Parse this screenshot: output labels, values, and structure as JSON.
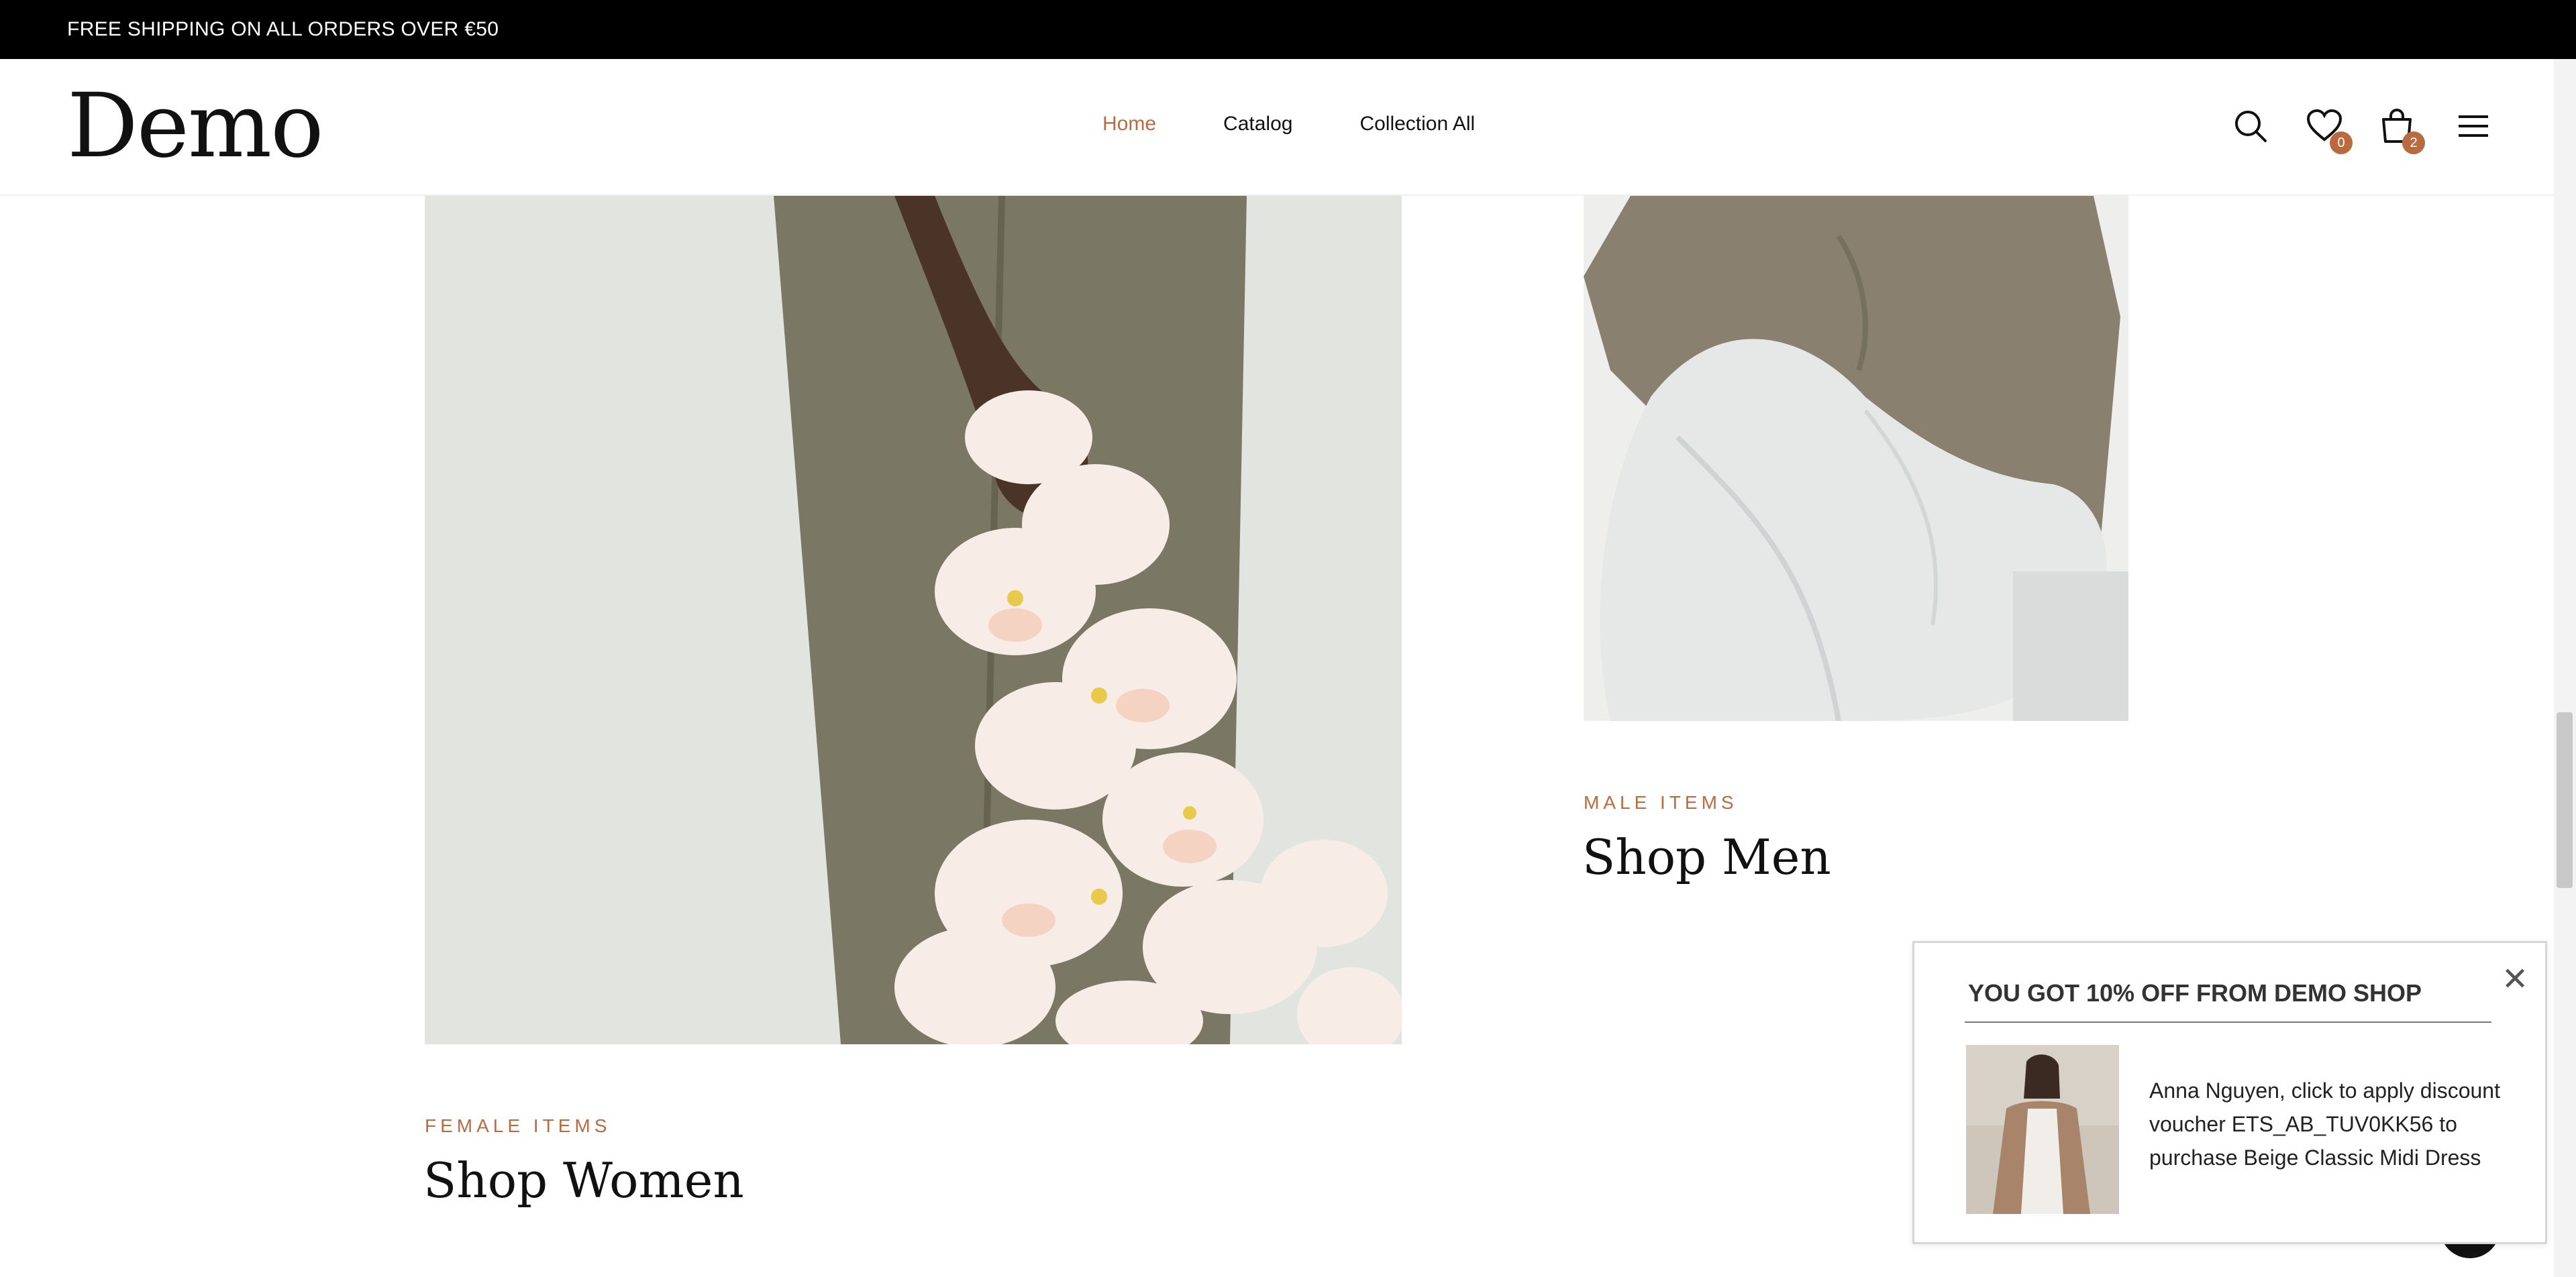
{
  "announcement": {
    "text": "FREE SHIPPING ON ALL ORDERS OVER €50"
  },
  "header": {
    "logo": "Demo",
    "nav": [
      {
        "label": "Home",
        "active": true
      },
      {
        "label": "Catalog",
        "active": false
      },
      {
        "label": "Collection All",
        "active": false
      }
    ],
    "icons": {
      "search": "search-icon",
      "wishlist": "heart-icon",
      "cart": "shopping-bag-icon",
      "menu": "hamburger-menu-icon"
    },
    "wishlist_count": "0",
    "cart_count": "2"
  },
  "categories": {
    "women": {
      "eyebrow": "FEMALE ITEMS",
      "title": "Shop Women"
    },
    "men": {
      "eyebrow": "MALE ITEMS",
      "title": "Shop Men"
    }
  },
  "popup": {
    "title": "YOU GOT 10% OFF FROM DEMO SHOP",
    "message": "Anna Nguyen, click to apply discount voucher ETS_AB_TUV0KK56 to purchase Beige Classic Midi Dress"
  },
  "colors": {
    "accent": "#b96a3f",
    "announcement_bg": "#000000"
  }
}
